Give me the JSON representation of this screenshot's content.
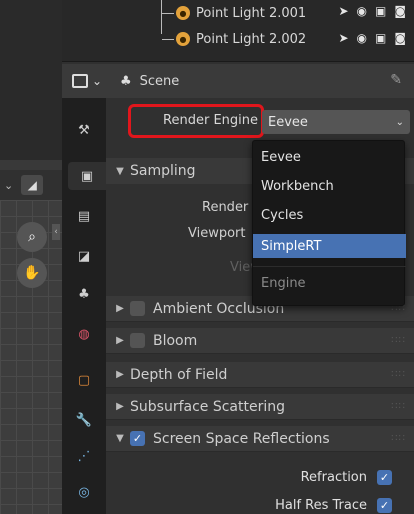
{
  "outliner": {
    "items": [
      {
        "label": "Point Light 2.001"
      },
      {
        "label": "Point Light 2.002"
      }
    ],
    "row_icons": [
      "select-arrow-icon",
      "eye-icon",
      "monitor-icon",
      "camera-icon"
    ]
  },
  "viewport": {
    "header_chevron": "⌄",
    "editor_icon": "◢",
    "tools": [
      "zoom-icon",
      "hand-pan-icon"
    ]
  },
  "properties": {
    "header": {
      "title": "Scene"
    },
    "render_engine": {
      "label": "Render Engine",
      "value": "Eevee"
    },
    "sampling": {
      "label": "Sampling",
      "render_label": "Render",
      "viewport_label": "Viewport",
      "denoising_label": "Viewport Denoising"
    },
    "sections": [
      {
        "label": "Ambient Occlusion",
        "has_checkbox": true,
        "checked": false,
        "expanded": false
      },
      {
        "label": "Bloom",
        "has_checkbox": true,
        "checked": false,
        "expanded": false
      },
      {
        "label": "Depth of Field",
        "has_checkbox": false,
        "expanded": false
      },
      {
        "label": "Subsurface Scattering",
        "has_checkbox": false,
        "expanded": false
      },
      {
        "label": "Screen Space Reflections",
        "has_checkbox": true,
        "checked": true,
        "expanded": true
      }
    ],
    "ssr_props": [
      {
        "label": "Refraction",
        "checked": true
      },
      {
        "label": "Half Res Trace",
        "checked": true
      }
    ]
  },
  "dropdown": {
    "options": [
      "Eevee",
      "Workbench",
      "Cycles",
      "SimpleRT"
    ],
    "highlighted": "SimpleRT",
    "title": "Engine"
  },
  "colors": {
    "accent": "#4772b3",
    "highlight_box": "#e1161c",
    "light_icon": "#e3a23b"
  }
}
